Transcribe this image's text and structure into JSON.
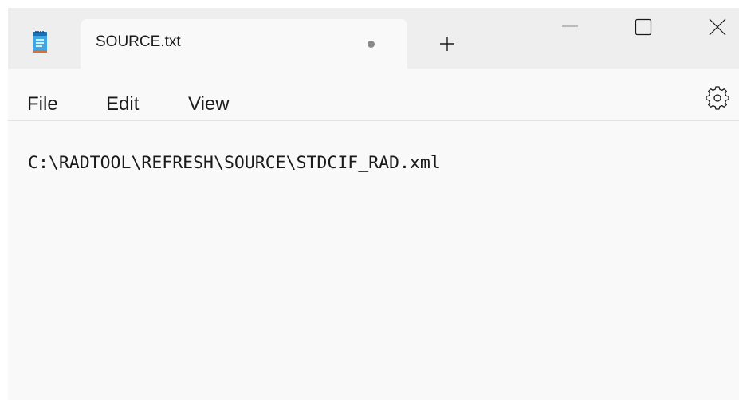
{
  "tab": {
    "title": "SOURCE.txt",
    "unsaved_indicator": "dot"
  },
  "icons": {
    "app": "notepad-icon",
    "new_tab": "plus-icon",
    "minimize": "minimize-icon",
    "maximize": "maximize-icon",
    "close": "close-icon",
    "settings": "gear-icon"
  },
  "menu": {
    "file": "File",
    "edit": "Edit",
    "view": "View"
  },
  "editor": {
    "content": "C:\\RADTOOL\\REFRESH\\SOURCE\\STDCIF_RAD.xml"
  },
  "colors": {
    "titlebar": "#eeeeee",
    "surface": "#f9f9f9",
    "text": "#1a1a1a",
    "icon_accent": "#1a8fd6"
  }
}
